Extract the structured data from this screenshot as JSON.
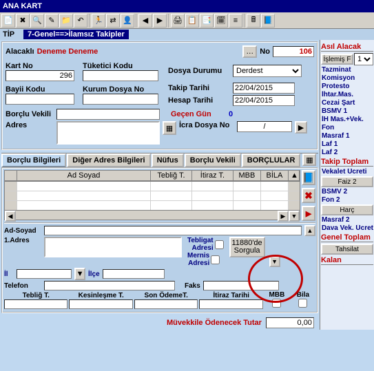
{
  "window": {
    "title": "ANA KART"
  },
  "tip": {
    "label": "TİP",
    "value": "7-Genel==>İlamsız Takipler"
  },
  "header": {
    "alacakli_label": "Alacaklı",
    "alacakli_value": "Deneme Deneme",
    "no_label": "No",
    "no_value": "106"
  },
  "form": {
    "kart_no_label": "Kart No",
    "kart_no_value": "296",
    "tuketici_kodu_label": "Tüketici Kodu",
    "tuketici_kodu_value": "",
    "bayii_kodu_label": "Bayii Kodu",
    "bayii_kodu_value": "",
    "kurum_dosya_no_label": "Kurum Dosya No",
    "kurum_dosya_no_value": "",
    "dosya_durumu_label": "Dosya Durumu",
    "dosya_durumu_value": "Derdest",
    "takip_tarihi_label": "Takip Tarihi",
    "takip_tarihi_value": "22/04/2015",
    "hesap_tarihi_label": "Hesap Tarihi",
    "hesap_tarihi_value": "22/04/2015",
    "borclu_vekili_label": "Borçlu Vekili",
    "borclu_vekili_value": "",
    "adres_label": "Adres",
    "gecen_gun_label": "Geçen Gün",
    "gecen_gun_value": "0",
    "icra_dosya_no_label": "İcra Dosya No",
    "icra_dosya_no_value": "/"
  },
  "tabs": {
    "t1": "Borçlu Bilgileri",
    "t2": "Diğer Adres Bilgileri",
    "t3": "Nüfus",
    "t4": "Borçlu Vekili",
    "t5": "BORÇLULAR"
  },
  "grid": {
    "h1": "Ad Soyad",
    "h2": "Tebliğ T.",
    "h3": "İtiraz T.",
    "h4": "MBB",
    "h5": "BİLA"
  },
  "bottom": {
    "ad_soyad_label": "Ad-Soyad",
    "adres1_label": "1.Adres",
    "il_label": "İl",
    "ilce_label": "İlçe",
    "telefon_label": "Telefon",
    "tebligat_label1": "Tebligat",
    "tebligat_label2": "Adresi",
    "mernis_label1": "Mernis",
    "mernis_label2": "Adresi",
    "faks_label": "Faks",
    "sorgula_btn_l1": "11880'de",
    "sorgula_btn_l2": "Sorgula",
    "teblig_t_label": "Tebliğ T.",
    "kesinlesme_t_label": "Kesinleşme T.",
    "son_odeme_t_label": "Son ÖdemeT.",
    "itiraz_tarihi_label": "İtiraz Tarihi",
    "mbb_label": "MBB",
    "bila_label": "Bila"
  },
  "footer": {
    "muvekkile_label": "Müvekkile Ödenecek Tutar",
    "muvekkile_value": "0,00"
  },
  "side": {
    "asil_alacak": "Asıl Alacak",
    "islemis_f": "İşlemiş F",
    "islemis_sel": "1.",
    "tazminat": "Tazminat",
    "komisyon": "Komisyon",
    "protesto": "Protesto",
    "ihtar_mas": "İhtar.Mas.",
    "cezai_sart": "Cezai Şart",
    "bsmv1": "BSMV 1",
    "ih_mas_vek": "İH Mas.+Vek.",
    "fon": "Fon",
    "masraf1": "Masraf 1",
    "laf1": "Laf 1",
    "laf2": "Laf 2",
    "takip_toplam": "Takip Toplam",
    "vekalet_ucreti": "Vekalet Ücreti",
    "faiz2": "Faiz 2",
    "bsmv2": "BSMV 2",
    "fon2": "Fon 2",
    "harc": "Harç",
    "masraf2": "Masraf 2",
    "dava_vek_ucret": "Dava Vek. Ücret",
    "genel_toplam": "Genel Toplam",
    "tahsilat": "Tahsilat",
    "kalan": "Kalan"
  },
  "icons": {
    "i1": "📄",
    "i2": "✖",
    "i3": "🔍",
    "i4": "✎",
    "i5": "📁",
    "i6": "↶",
    "i7": "🏃",
    "i8": "⇄",
    "i9": "👤",
    "i10": "◀",
    "i11": "▶",
    "i12": "🖨",
    "i13": "📋",
    "i14": "📑",
    "i15": "🗓",
    "i16": "≡",
    "i17": "🖩",
    "i18": "📘",
    "grid": "▦",
    "right": "▶",
    "x": "✖",
    "dots": "…",
    "down": "▼",
    "left": "◀",
    "big_x": "✖"
  }
}
